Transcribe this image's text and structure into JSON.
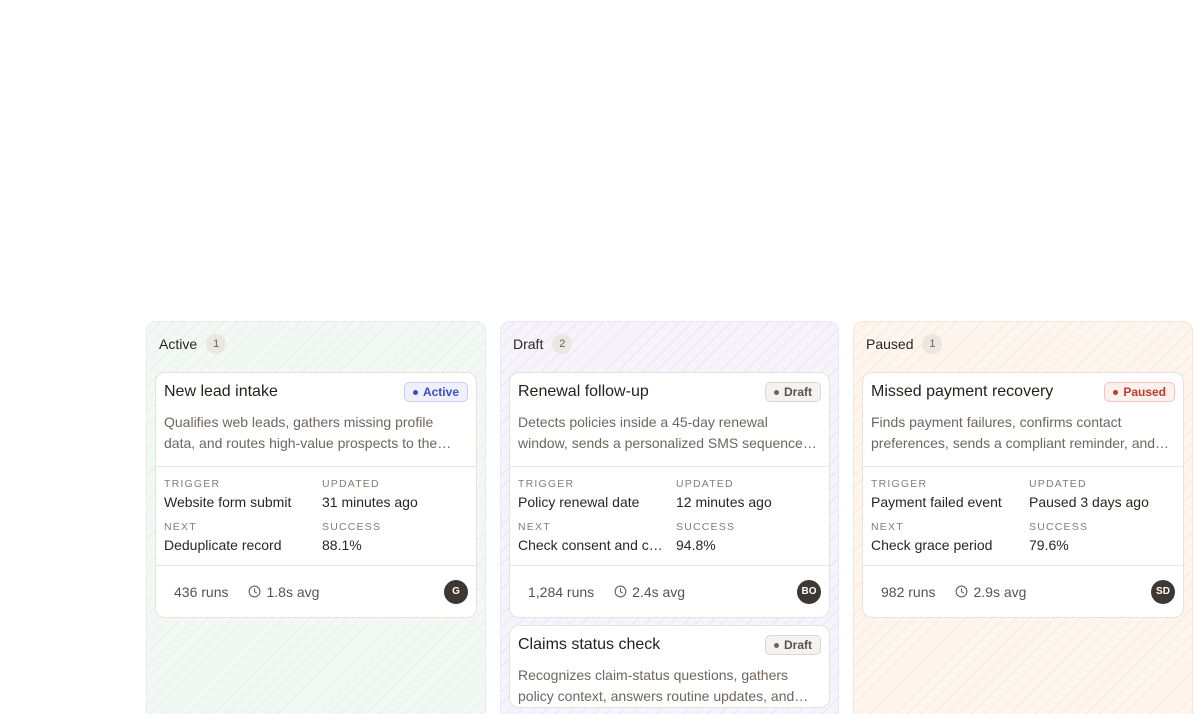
{
  "columns": [
    {
      "title": "Active",
      "count": "1",
      "cards": [
        {
          "title": "New lead intake",
          "status": "Active",
          "description": "Qualifies web leads, gathers missing profile data, and routes high-value prospects to the right owner.",
          "trigger_label": "TRIGGER",
          "trigger": "Website form submit",
          "updated_label": "UPDATED",
          "updated": "31 minutes ago",
          "next_label": "NEXT",
          "next": "Deduplicate record",
          "success_label": "SUCCESS",
          "success": "88.1%",
          "runs": "436 runs",
          "avg": "1.8s avg",
          "avatar": "G"
        }
      ]
    },
    {
      "title": "Draft",
      "count": "2",
      "cards": [
        {
          "title": "Renewal follow-up",
          "status": "Draft",
          "description": "Detects policies inside a 45-day renewal window, sends a personalized SMS sequence, and writes notes.",
          "trigger_label": "TRIGGER",
          "trigger": "Policy renewal date",
          "updated_label": "UPDATED",
          "updated": "12 minutes ago",
          "next_label": "NEXT",
          "next": "Check consent and channel",
          "success_label": "SUCCESS",
          "success": "94.8%",
          "runs": "1,284 runs",
          "avg": "2.4s avg",
          "avatar": "BO"
        },
        {
          "title": "Claims status check",
          "status": "Draft",
          "description": "Recognizes claim-status questions, gathers policy context, answers routine updates, and escalates."
        }
      ]
    },
    {
      "title": "Paused",
      "count": "1",
      "cards": [
        {
          "title": "Missed payment recovery",
          "status": "Paused",
          "description": "Finds payment failures, confirms contact preferences, sends a compliant reminder, and logs outcome.",
          "trigger_label": "TRIGGER",
          "trigger": "Payment failed event",
          "updated_label": "UPDATED",
          "updated": "Paused 3 days ago",
          "next_label": "NEXT",
          "next": "Check grace period",
          "success_label": "SUCCESS",
          "success": "79.6%",
          "runs": "982 runs",
          "avg": "2.9s avg",
          "avatar": "SD"
        }
      ]
    }
  ],
  "icons": {
    "avg": "clock-icon",
    "status": "dot-icon"
  }
}
